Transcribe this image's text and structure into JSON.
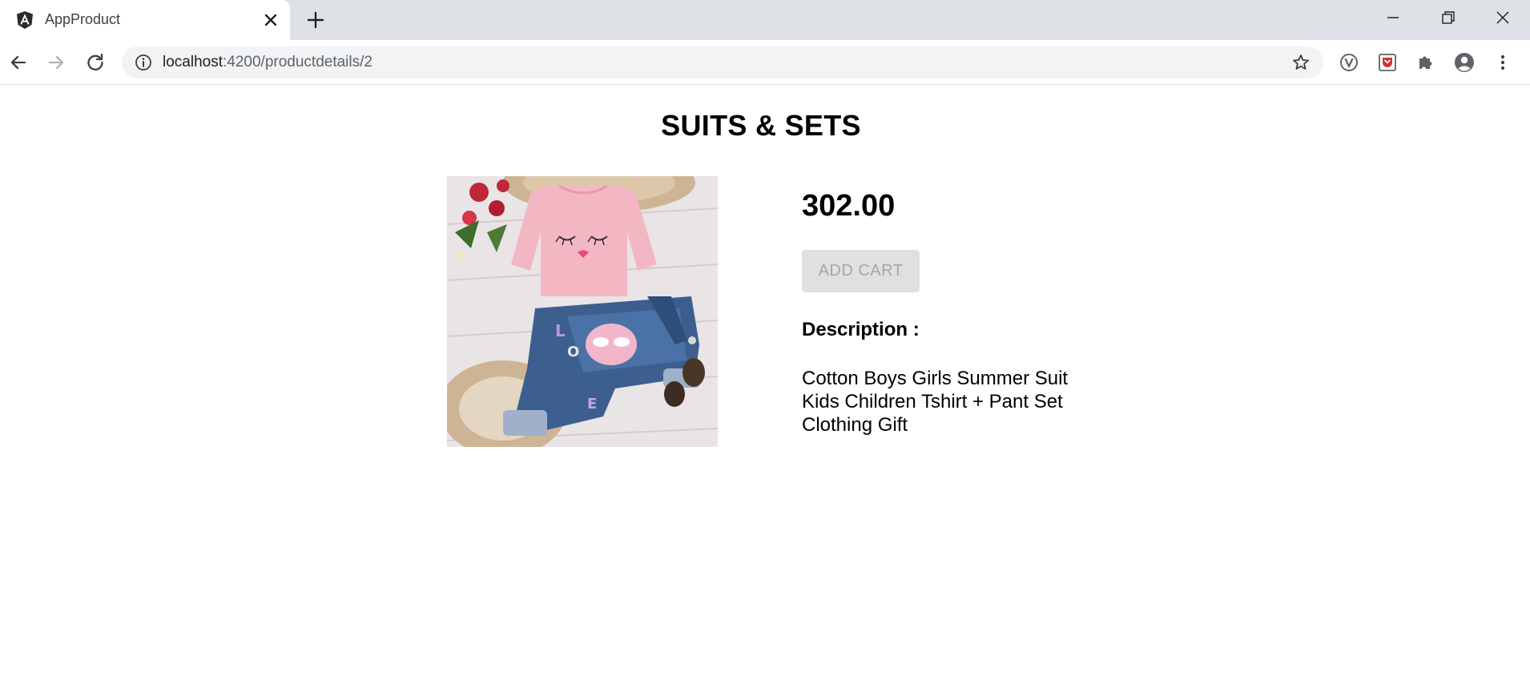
{
  "browser": {
    "tab_title": "AppProduct",
    "url_host": "localhost",
    "url_path": ":4200/productdetails/2"
  },
  "icons": {
    "favicon": "angular-icon",
    "tab_close": "close-icon",
    "new_tab": "plus-icon",
    "minimize": "minimize-icon",
    "restore": "restore-icon",
    "close_window": "close-icon",
    "back": "arrow-left-icon",
    "forward": "arrow-right-icon",
    "reload": "reload-icon",
    "site_info": "info-icon",
    "bookmark": "star-icon",
    "ext_v": "vimium-icon",
    "ext_pocket": "pocket-icon",
    "extensions": "puzzle-icon",
    "profile": "account-icon",
    "menu": "kebab-menu-icon"
  },
  "product": {
    "category_title": "SUITS & SETS",
    "price": "302.00",
    "add_cart_label": "ADD CART",
    "description_label": "Description :",
    "description": "Cotton Boys Girls Summer Suit Kids Children Tshirt + Pant Set Clothing Gift"
  },
  "colors": {
    "tabstrip": "#dee1e6",
    "omnibox": "#f1f3f4",
    "button_bg": "#e0e0e0",
    "button_text": "#a6a6a6"
  }
}
